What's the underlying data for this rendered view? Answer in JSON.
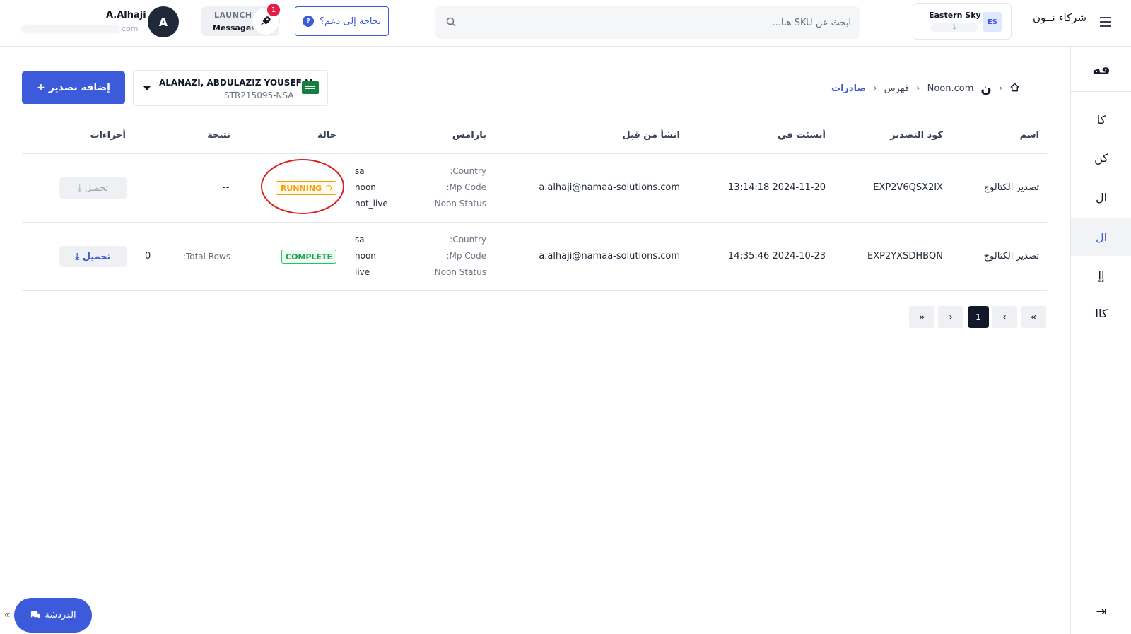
{
  "header": {
    "user_name": "A.Alhaji",
    "user_email_tail": "com",
    "avatar_initial": "A",
    "launch_title": "LAUNCH",
    "launch_sub": "Messages",
    "notification_count": "1",
    "support_label": "بحاجة إلى دعم؟",
    "search_placeholder": "ابحث عن SKU هنا...",
    "store_name": "Eastern Sky",
    "store_initials": "ES",
    "store_sub": "1",
    "logo": "شركاء نــون"
  },
  "sidebar": {
    "top": "فه",
    "items": [
      "كا",
      "كن",
      "ال",
      "ال",
      "إإ",
      "كاا"
    ],
    "active_index": 3,
    "collapse_glyph": "⇥"
  },
  "toolbar": {
    "add_export_label": "+ إضافة تصدير",
    "seller_name": "ALANAZI, ABDULAZIZ YOUSEF M",
    "seller_code": "STR215095-NSA"
  },
  "breadcrumb": {
    "marketplace": "Noon.com",
    "catalog": "فهرس",
    "current": "صادرات",
    "logo": "ن"
  },
  "table": {
    "headers": {
      "name": "اسم",
      "export_code": "كود التصدير",
      "created_at": "أنشئت في",
      "created_by": "انشأ من قبل",
      "params": "بارامس",
      "status": "حالة",
      "result": "نتيجة",
      "actions": "أجراءات"
    },
    "param_labels": {
      "country": ":Country",
      "mp_code": ":Mp Code",
      "noon_status": ":Noon Status"
    },
    "rows": [
      {
        "name": "تصدير الكتالوج",
        "export_code": "EXP2V6QSX2IX",
        "created_at": "13:14:18 2024-11-20",
        "created_by": "a.alhaji@namaa-solutions.com",
        "country": "sa",
        "mp_code": "noon",
        "noon_status": "not_live",
        "status": "RUNNING",
        "result": "--",
        "download": "⤓ تحميل"
      },
      {
        "name": "تصدير الكتالوج",
        "export_code": "EXP2YXSDHBQN",
        "created_at": "14:35:46 2024-10-23",
        "created_by": "a.alhaji@namaa-solutions.com",
        "country": "sa",
        "mp_code": "noon",
        "noon_status": "live",
        "status": "COMPLETE",
        "result_label": ":Total Rows",
        "result_value": "0",
        "download": "⤓ تحميل"
      }
    ]
  },
  "pagination": {
    "first": "«",
    "prev": "‹",
    "current": "1",
    "next": "›",
    "last": "»"
  },
  "chat": {
    "label": "الدردشة",
    "collapse": "«"
  },
  "colors": {
    "accent": "#3b5bdb",
    "running": "#f59e0b",
    "complete": "#22c55e",
    "annotation_circle": "#e11d1d"
  }
}
